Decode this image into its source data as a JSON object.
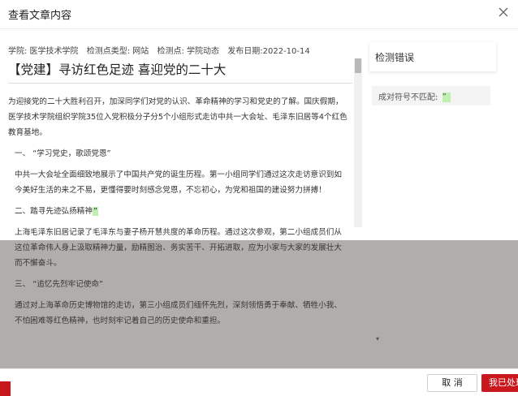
{
  "dialog": {
    "title": "查看文章内容",
    "close_icon": "close-icon"
  },
  "article": {
    "meta": {
      "school": "学院: 医学技术学院",
      "type": "检测点类型: 网站",
      "point": "检测点: 学院动态",
      "date": "发布日期:2022-10-14"
    },
    "title": "【党建】寻访红色足迹 喜迎党的二十大",
    "paragraphs": [
      "为迎接党的二十大胜利召开，加深同学们对党的认识、革命精神的学习和党史的了解。国庆假期，医学技术学院组织学院35位入党积极分子分5个小组形式走访中共一大会址、毛泽东旧居等4个红色教育基地。",
      "一、 “学习党史，歌颂党恩”",
      "中共一大会址全面细致地展示了中国共产党的诞生历程。第一小组同学们通过这次走访意识到如今美好生活的来之不易，更懂得要时刻感念党恩，不忘初心，为党和祖国的建设努力拼搏！",
      "二、踏寻先迹弘扬精神",
      "上海毛泽东旧居记录了毛泽东与妻子杨开慧共度的革命历程。通过这次参观，第二小组成员们从这位革命伟人身上汲取精神力量，励精图治、务实苦干、开拓进取，应为小家与大家的发展壮大而不懈奋斗。",
      "三、 “追忆先烈牢记使命”",
      "通过对上海革命历史博物馆的走访，第三小组成员们缅怀先烈，深刻领悟勇于奉献、牺牲小我、不怕困难等红色精神，也时刻牢记着自己的历史使命和重担。"
    ],
    "highlight_mark": "”",
    "scroll_down_icon": "▾"
  },
  "errors": {
    "panel_title": "检测错误",
    "items": [
      {
        "label": "成对符号不匹配: ",
        "mark": "”"
      }
    ]
  },
  "footer": {
    "cancel_label": "取 消",
    "done_label": "我已处理"
  },
  "colors": {
    "primary_red": "#c8171d",
    "highlight_green": "#bff0b0"
  }
}
